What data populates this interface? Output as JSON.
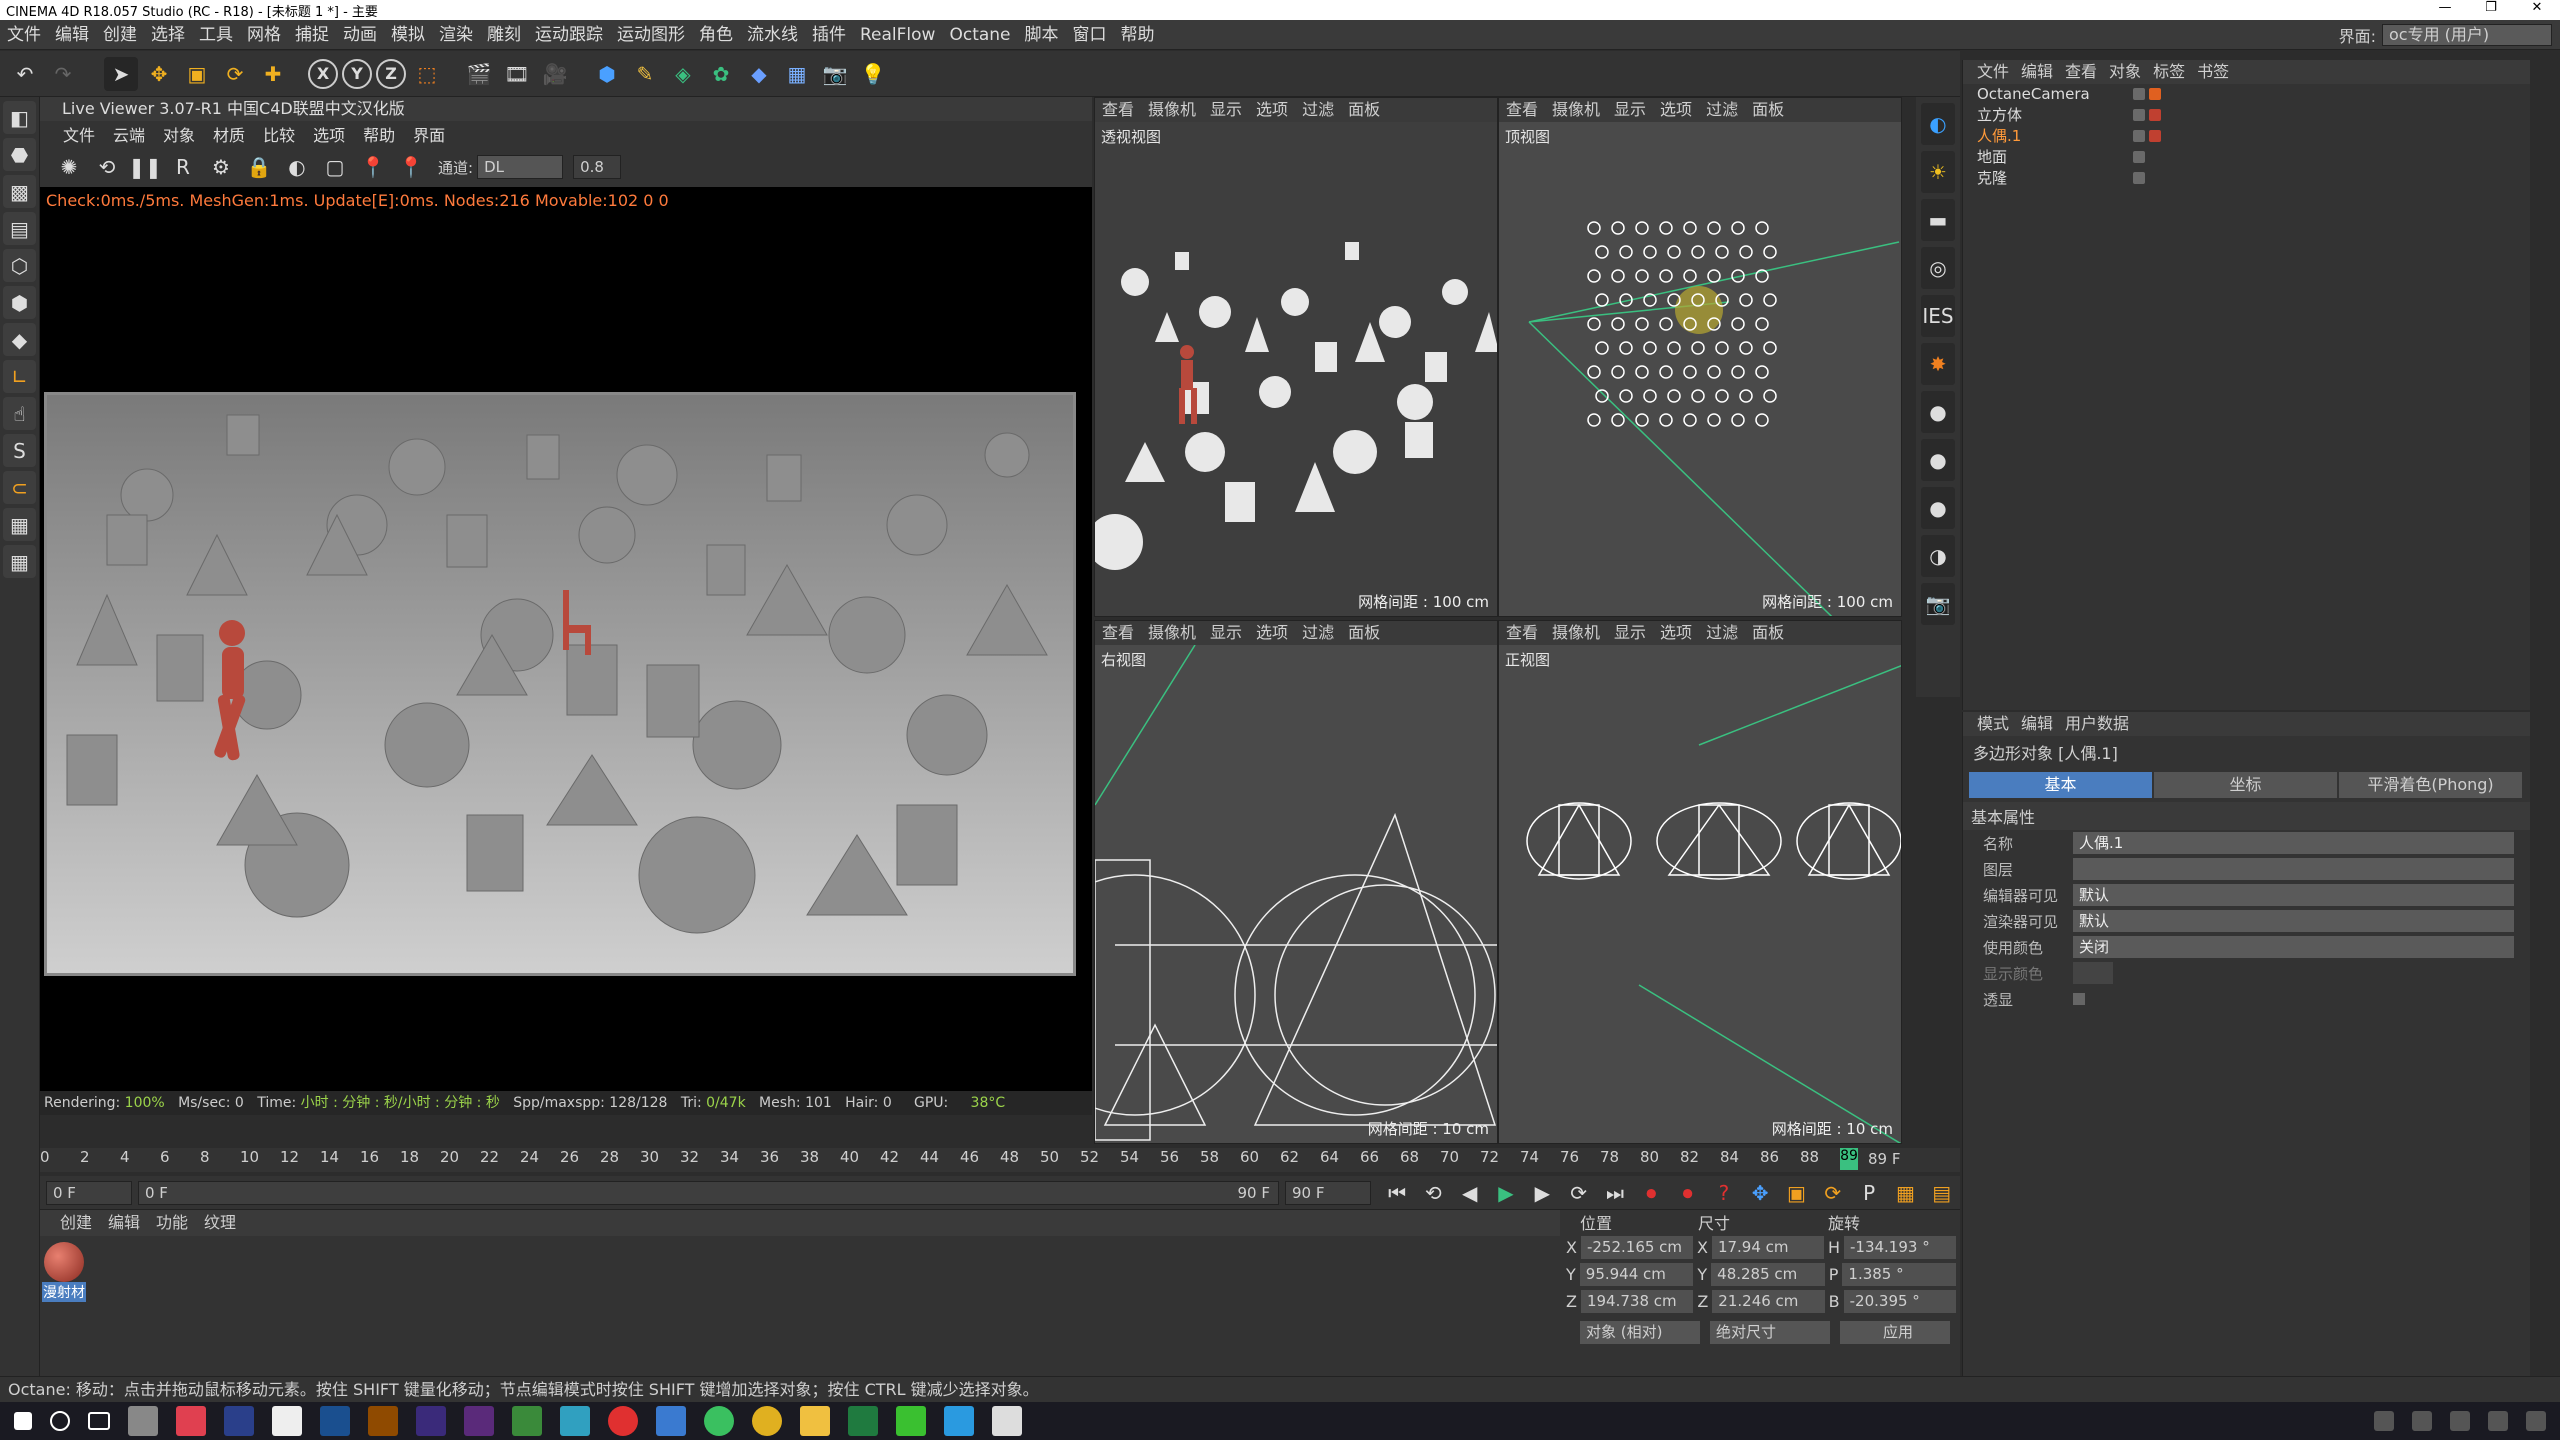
{
  "window": {
    "title": "CINEMA 4D R18.057 Studio (RC - R18) - [未标题 1 *] - 主要"
  },
  "menubar": {
    "items": [
      "文件",
      "编辑",
      "创建",
      "选择",
      "工具",
      "网格",
      "捕捉",
      "动画",
      "模拟",
      "渲染",
      "雕刻",
      "运动跟踪",
      "运动图形",
      "角色",
      "流水线",
      "插件",
      "RealFlow",
      "Octane",
      "脚本",
      "窗口",
      "帮助"
    ],
    "layout_label": "界面:",
    "layout_value": "oc专用 (用户)"
  },
  "toolbar": {
    "axis_x": "X",
    "axis_y": "Y",
    "axis_z": "Z"
  },
  "live_viewer": {
    "title": "Live Viewer 3.07-R1 中国C4D联盟中文汉化版",
    "menu": [
      "文件",
      "云端",
      "对象",
      "材质",
      "比较",
      "选项",
      "帮助",
      "界面"
    ],
    "channel_label": "通道:",
    "channel_value": "DL",
    "value": "0.8",
    "status": "Check:0ms./5ms. MeshGen:1ms. Update[E]:0ms. Nodes:216 Movable:102  0 0",
    "footer": {
      "rendering": "Rendering:",
      "rendering_val": "100%",
      "mssec": "Ms/sec: 0",
      "time": "Time:",
      "time_val": "小时 : 分钟 : 秒/小时 : 分钟 : 秒",
      "spp": "Spp/maxspp: 128/128",
      "tri": "Tri:",
      "tri_val": "0/47k",
      "mesh": "Mesh: 101",
      "hair": "Hair: 0",
      "gpu": "GPU:",
      "gpu_val": "38°C"
    }
  },
  "viewports": {
    "menu": [
      "查看",
      "摄像机",
      "显示",
      "选项",
      "过滤",
      "面板"
    ],
    "perspective": {
      "name": "透视视图",
      "grid": "网格间距 : 100 cm"
    },
    "top": {
      "name": "顶视图",
      "grid": "网格间距 : 100 cm"
    },
    "right": {
      "name": "右视图",
      "grid": "网格间距 : 10 cm"
    },
    "front": {
      "name": "正视图",
      "grid": "网格间距 : 10 cm"
    }
  },
  "object_manager": {
    "menu": [
      "文件",
      "编辑",
      "查看",
      "对象",
      "标签",
      "书签"
    ],
    "objects": [
      {
        "name": "OctaneCamera",
        "selected": false
      },
      {
        "name": "立方体",
        "selected": false
      },
      {
        "name": "人偶.1",
        "selected": true
      },
      {
        "name": "地面",
        "selected": false
      },
      {
        "name": "克隆",
        "selected": false
      }
    ]
  },
  "attributes": {
    "menu": [
      "模式",
      "编辑",
      "用户数据"
    ],
    "object_title": "多边形对象 [人偶.1]",
    "tabs": [
      "基本",
      "坐标",
      "平滑着色(Phong)"
    ],
    "section": "基本属性",
    "props": [
      {
        "label": "名称",
        "value": "人偶.1"
      },
      {
        "label": "图层",
        "value": ""
      },
      {
        "label": "编辑器可见",
        "value": "默认"
      },
      {
        "label": "渲染器可见",
        "value": "默认"
      },
      {
        "label": "使用颜色",
        "value": "关闭"
      },
      {
        "label": "显示颜色",
        "value": ""
      },
      {
        "label": "透显",
        "value": ""
      }
    ]
  },
  "timeline": {
    "ticks": [
      "0",
      "2",
      "4",
      "6",
      "8",
      "10",
      "12",
      "14",
      "16",
      "18",
      "20",
      "22",
      "24",
      "26",
      "28",
      "30",
      "32",
      "34",
      "36",
      "38",
      "40",
      "42",
      "44",
      "46",
      "48",
      "50",
      "52",
      "54",
      "56",
      "58",
      "60",
      "62",
      "64",
      "66",
      "68",
      "70",
      "72",
      "74",
      "76",
      "78",
      "80",
      "82",
      "84",
      "86",
      "88"
    ],
    "current": "89",
    "end_label": "89 F",
    "start_field": "0 F",
    "range_start": "0 F",
    "range_end": "90 F",
    "max_field": "90 F"
  },
  "material_manager": {
    "menu": [
      "创建",
      "编辑",
      "功能",
      "纹理"
    ],
    "material_name": "漫射材"
  },
  "coordinates": {
    "headers": [
      "位置",
      "尺寸",
      "旋转"
    ],
    "rows": [
      {
        "axis": "X",
        "pos": "-252.165 cm",
        "size_axis": "X",
        "size": "17.94 cm",
        "rot_axis": "H",
        "rot": "-134.193 °"
      },
      {
        "axis": "Y",
        "pos": "95.944 cm",
        "size_axis": "Y",
        "size": "48.285 cm",
        "rot_axis": "P",
        "rot": "1.385 °"
      },
      {
        "axis": "Z",
        "pos": "194.738 cm",
        "size_axis": "Z",
        "size": "21.246 cm",
        "rot_axis": "B",
        "rot": "-20.395 °"
      }
    ],
    "mode": "对象 (相对)",
    "size_mode": "绝对尺寸",
    "apply": "应用"
  },
  "statusbar": {
    "text": "Octane:  移动：点击并拖动鼠标移动元素。按住 SHIFT 键量化移动；节点编辑模式时按住 SHIFT 键增加选择对象；按住 CTRL 键减少选择对象。"
  },
  "colors": {
    "accent": "#4a7dbf",
    "selected": "#ff9a3a",
    "status": "#ff7a3c"
  }
}
